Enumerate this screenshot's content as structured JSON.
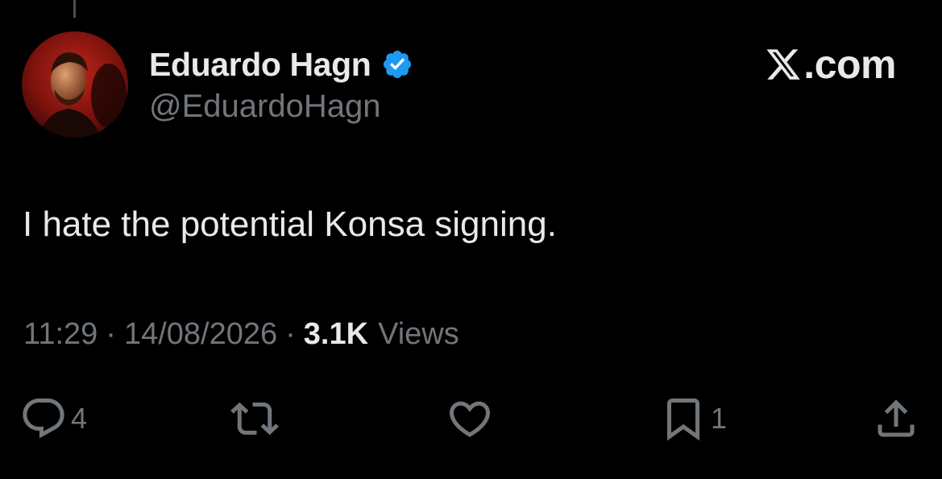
{
  "author": {
    "display_name": "Eduardo Hagn",
    "handle": "@EduardoHagn",
    "verified": true,
    "avatar_icon": "avatar-portrait"
  },
  "brand": {
    "suffix": ".com",
    "logo_icon": "x-logo-icon"
  },
  "tweet": {
    "text": "I hate the potential Konsa signing.",
    "time": "11:29",
    "date": "14/08/2026",
    "separator": "·",
    "views_count": "3.1K",
    "views_label": "Views"
  },
  "actions": {
    "reply": {
      "icon": "reply-icon",
      "count": "4"
    },
    "repost": {
      "icon": "repost-icon",
      "count": ""
    },
    "like": {
      "icon": "heart-icon",
      "count": ""
    },
    "bookmark": {
      "icon": "bookmark-icon",
      "count": "1"
    },
    "share": {
      "icon": "share-icon",
      "count": ""
    }
  },
  "colors": {
    "background": "#000000",
    "primary_text": "#e7e9ea",
    "secondary_text": "#71767b",
    "verified_blue": "#1d9bf0"
  }
}
